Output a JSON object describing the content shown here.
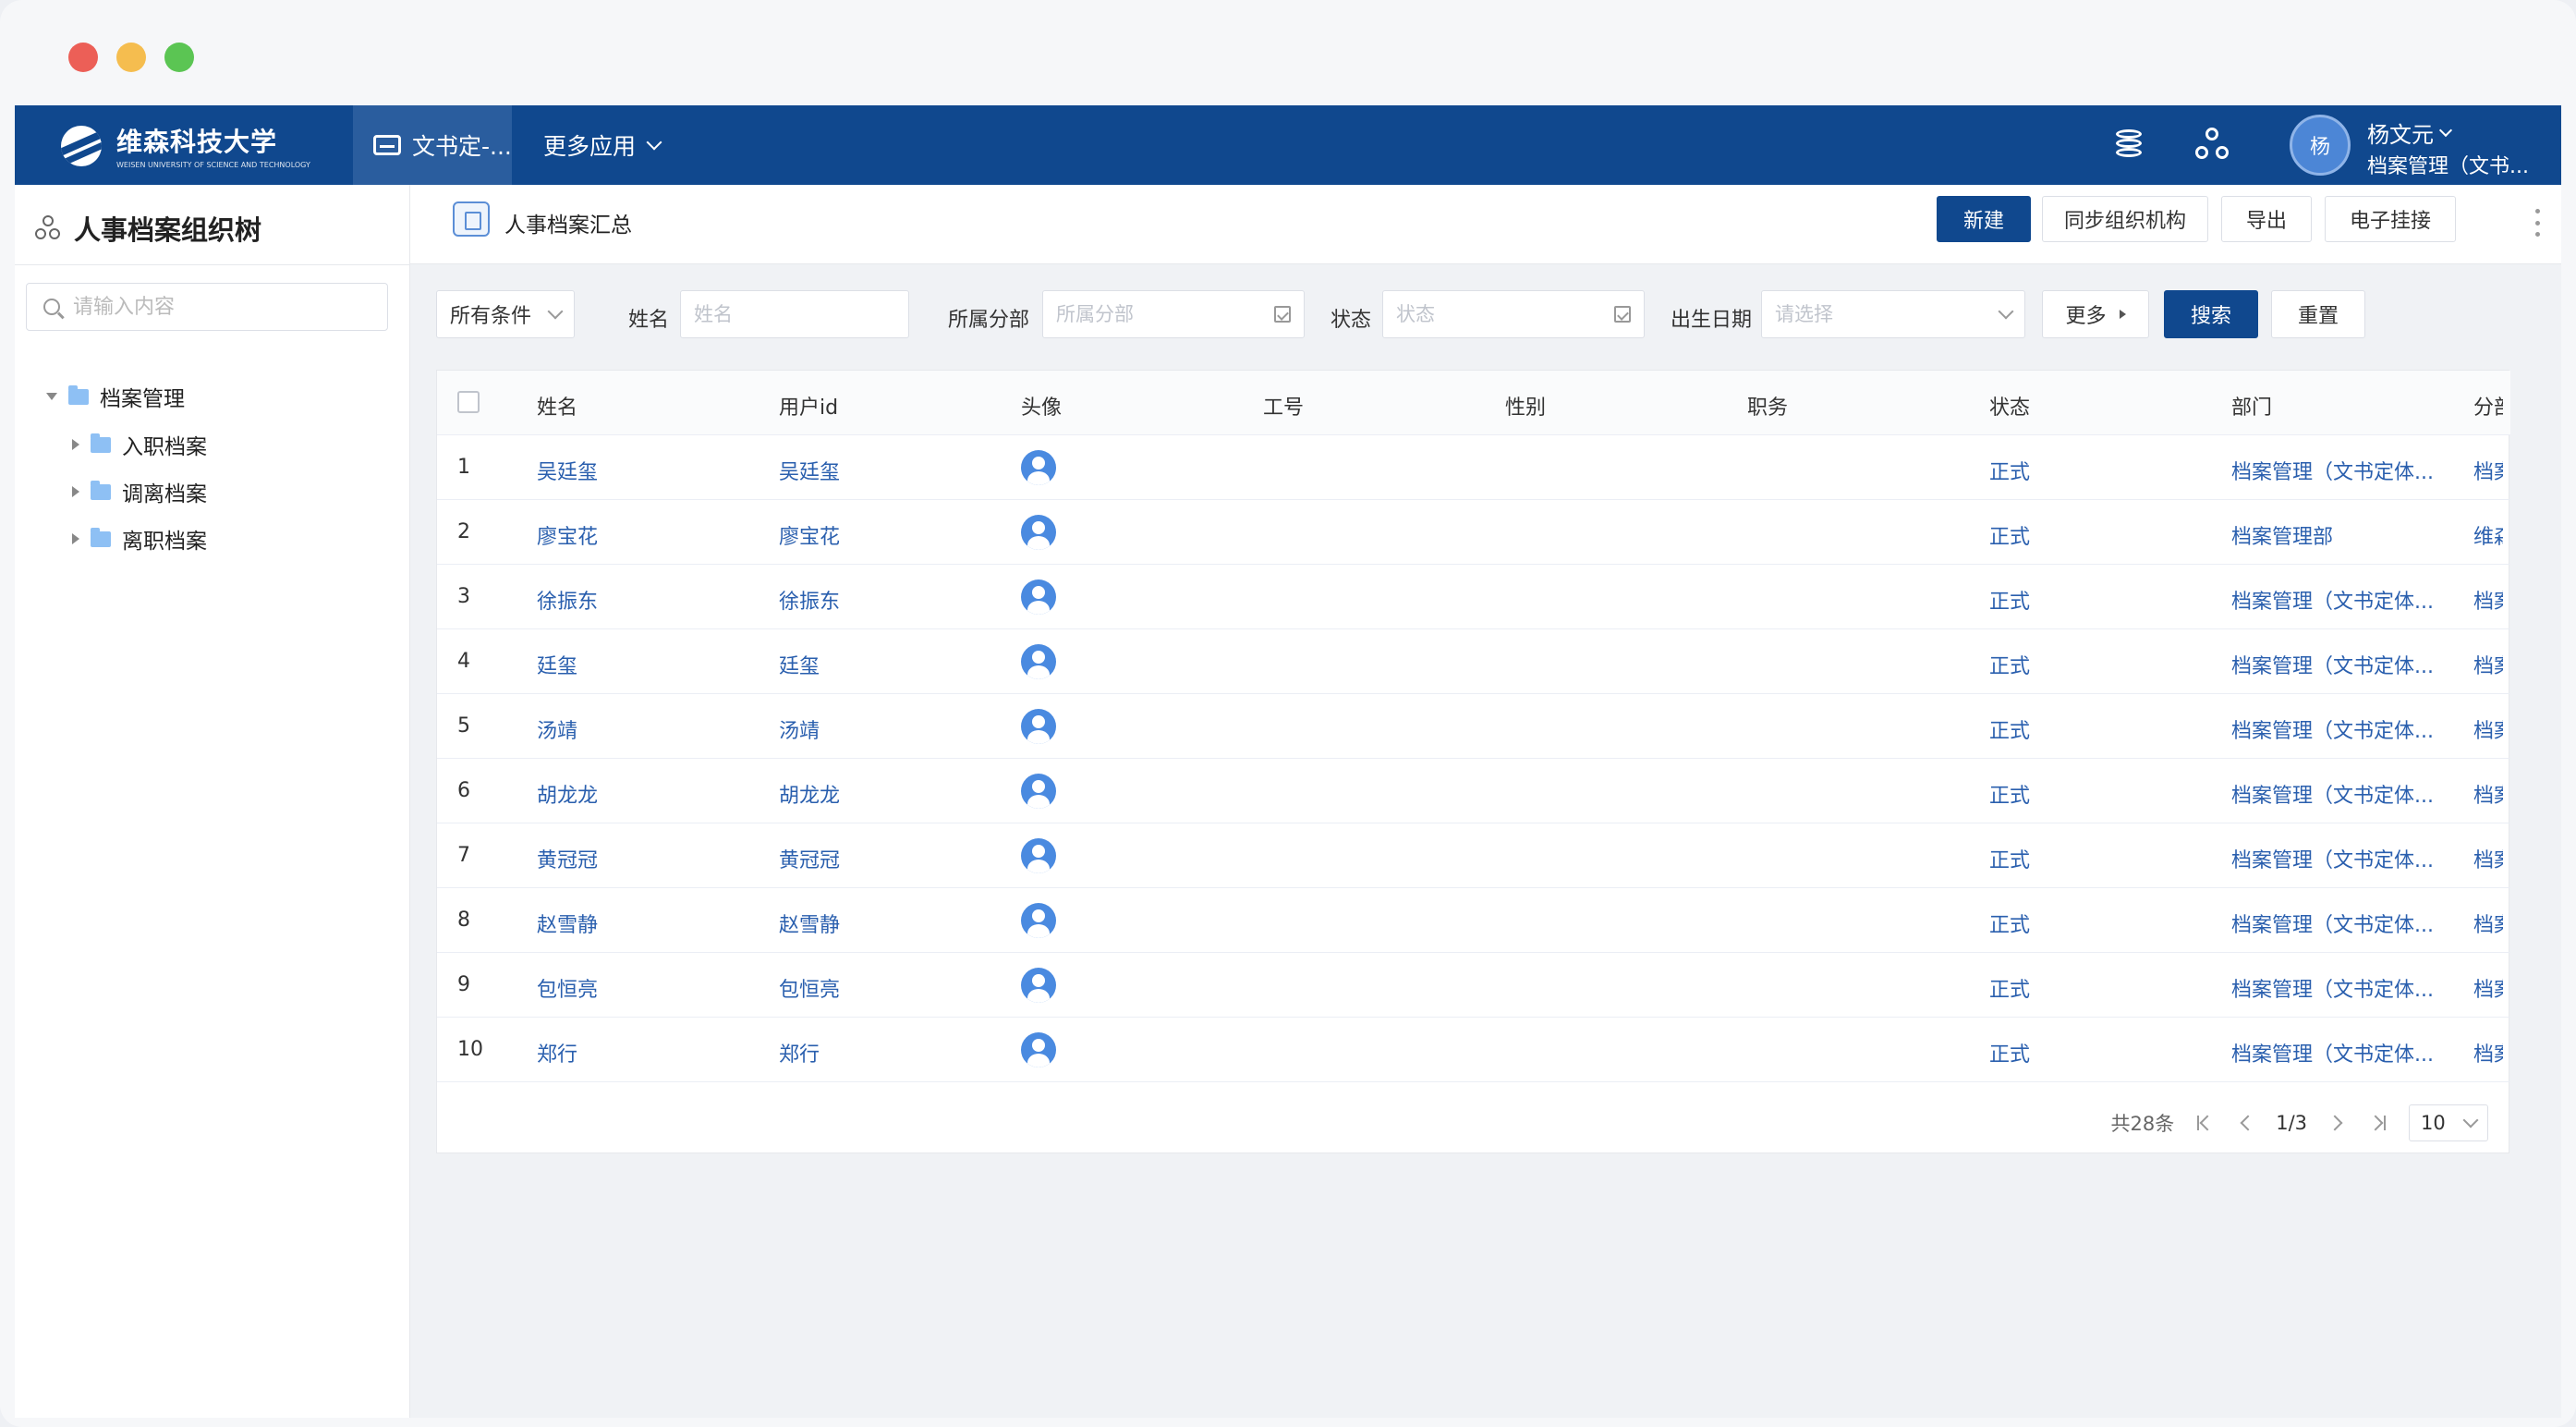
{
  "header": {
    "logo_cn": "维森科技大学",
    "logo_en": "WEISEN UNIVERSITY OF SCIENCE AND TECHNOLOGY",
    "active_tab": "文书定-...",
    "more_apps": "更多应用",
    "user_avatar_text": "杨",
    "user_name": "杨文元",
    "user_dept": "档案管理（文书...",
    "icons": [
      "database-icon",
      "org-structure-icon"
    ]
  },
  "sidebar": {
    "title": "人事档案组织树",
    "search_placeholder": "请输入内容",
    "root": "档案管理",
    "children": [
      "入职档案",
      "调离档案",
      "离职档案"
    ]
  },
  "toolbar": {
    "title": "人事档案汇总",
    "new": "新建",
    "sync": "同步组织机构",
    "export": "导出",
    "attach": "电子挂接"
  },
  "filters": {
    "condition": "所有条件",
    "name_label": "姓名",
    "name_placeholder": "姓名",
    "branch_label": "所属分部",
    "branch_placeholder": "所属分部",
    "status_label": "状态",
    "status_placeholder": "状态",
    "birth_label": "出生日期",
    "birth_placeholder": "请选择",
    "more": "更多",
    "search": "搜索",
    "reset": "重置"
  },
  "table": {
    "columns": [
      "姓名",
      "用户id",
      "头像",
      "工号",
      "性别",
      "职务",
      "状态",
      "部门",
      "分部"
    ],
    "rows": [
      {
        "no": "1",
        "name": "吴廷玺",
        "uid": "吴廷玺",
        "status": "正式",
        "dept": "档案管理（文书定体...",
        "branch": "档案"
      },
      {
        "no": "2",
        "name": "廖宝花",
        "uid": "廖宝花",
        "status": "正式",
        "dept": "档案管理部",
        "branch": "维森"
      },
      {
        "no": "3",
        "name": "徐振东",
        "uid": "徐振东",
        "status": "正式",
        "dept": "档案管理（文书定体...",
        "branch": "档案"
      },
      {
        "no": "4",
        "name": "廷玺",
        "uid": "廷玺",
        "status": "正式",
        "dept": "档案管理（文书定体...",
        "branch": "档案"
      },
      {
        "no": "5",
        "name": "汤靖",
        "uid": "汤靖",
        "status": "正式",
        "dept": "档案管理（文书定体...",
        "branch": "档案"
      },
      {
        "no": "6",
        "name": "胡龙龙",
        "uid": "胡龙龙",
        "status": "正式",
        "dept": "档案管理（文书定体...",
        "branch": "档案"
      },
      {
        "no": "7",
        "name": "黄冠冠",
        "uid": "黄冠冠",
        "status": "正式",
        "dept": "档案管理（文书定体...",
        "branch": "档案"
      },
      {
        "no": "8",
        "name": "赵雪静",
        "uid": "赵雪静",
        "status": "正式",
        "dept": "档案管理（文书定体...",
        "branch": "档案"
      },
      {
        "no": "9",
        "name": "包恒亮",
        "uid": "包恒亮",
        "status": "正式",
        "dept": "档案管理（文书定体...",
        "branch": "档案"
      },
      {
        "no": "10",
        "name": "郑行",
        "uid": "郑行",
        "status": "正式",
        "dept": "档案管理（文书定体...",
        "branch": "档案"
      }
    ]
  },
  "pagination": {
    "total": "共28条",
    "page": "1/3",
    "size": "10"
  }
}
